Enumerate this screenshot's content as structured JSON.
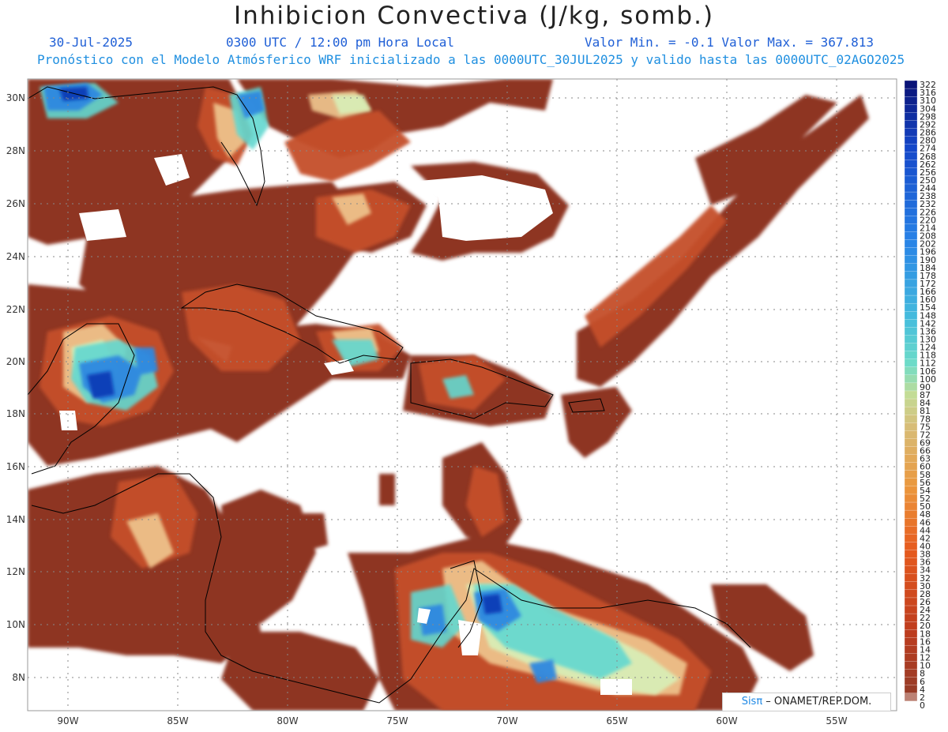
{
  "header": {
    "title": "Inhibicion Convectiva (J/kg, somb.)",
    "date": "30-Jul-2025",
    "time": "0300 UTC / 12:00 pm Hora Local",
    "minmax": "Valor Min. = -0.1  Valor Max. = 367.813",
    "forecast": "Pronóstico con el Modelo Atmósferico WRF inicializado a las 0000UTC_30JUL2025 y valido hasta las  0000UTC_02AGO2025"
  },
  "axes": {
    "lat_labels": [
      "30N",
      "28N",
      "26N",
      "24N",
      "22N",
      "20N",
      "18N",
      "16N",
      "14N",
      "12N",
      "10N",
      "8N"
    ],
    "lon_labels": [
      "90W",
      "85W",
      "80W",
      "75W",
      "70W",
      "65W",
      "60W",
      "55W"
    ]
  },
  "colorbar": {
    "levels": [
      "322",
      "316",
      "310",
      "304",
      "298",
      "292",
      "286",
      "280",
      "274",
      "268",
      "262",
      "256",
      "250",
      "244",
      "238",
      "232",
      "226",
      "220",
      "214",
      "208",
      "202",
      "196",
      "190",
      "184",
      "178",
      "172",
      "166",
      "160",
      "154",
      "148",
      "142",
      "136",
      "130",
      "124",
      "118",
      "112",
      "106",
      "100",
      "90",
      "87",
      "84",
      "81",
      "78",
      "75",
      "72",
      "69",
      "66",
      "63",
      "60",
      "58",
      "56",
      "54",
      "52",
      "50",
      "48",
      "46",
      "44",
      "42",
      "40",
      "38",
      "36",
      "34",
      "32",
      "30",
      "28",
      "26",
      "24",
      "22",
      "20",
      "18",
      "16",
      "14",
      "12",
      "10",
      "8",
      "6",
      "4",
      "2",
      "0"
    ]
  },
  "credit": {
    "sis": "Sisπ",
    "text": " – ONAMET/REP.DOM."
  },
  "colors": {
    "dark": "#8e3423",
    "mid": "#c5502a",
    "orange": "#dd7a3b",
    "light": "#f0c890",
    "pale": "#d8f0b8",
    "cyan": "#62d8d0",
    "blue": "#2f88e0",
    "deep": "#0d3fb8"
  }
}
